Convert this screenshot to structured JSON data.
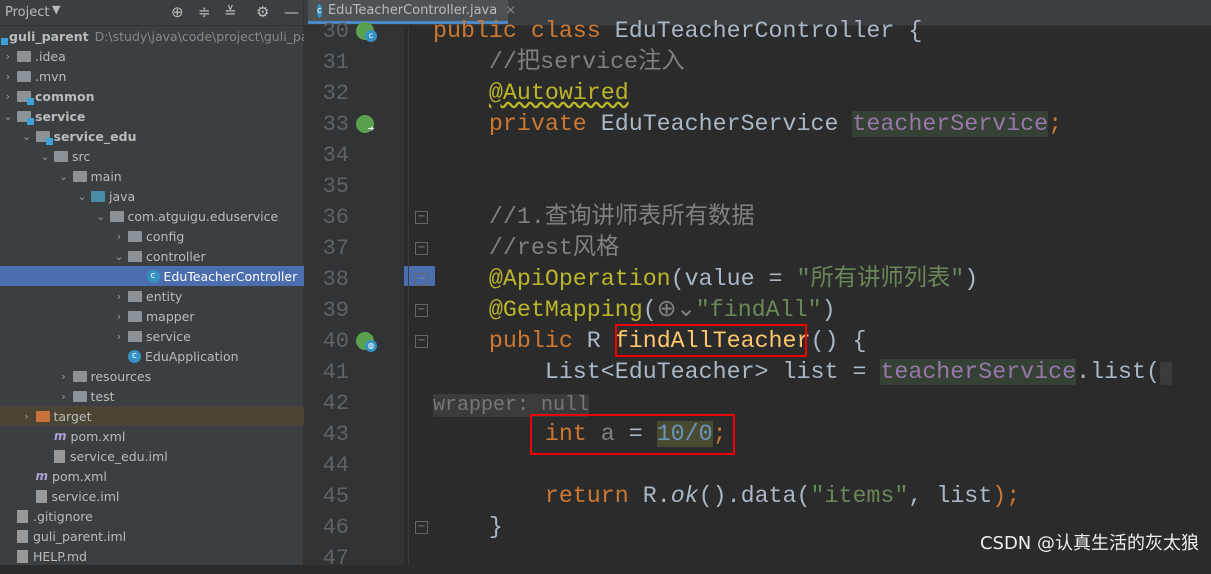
{
  "sidebar": {
    "title": "Project",
    "icons": [
      "dropdown-icon",
      "locate-icon",
      "expand-all-icon",
      "collapse-all-icon",
      "gear-icon",
      "minimize-icon"
    ],
    "items": [
      {
        "label": "guli_parent",
        "path": "D:\\study\\java\\code\\project\\guli_parent",
        "level": 0,
        "icon": "module",
        "bold": true
      },
      {
        "label": ".idea",
        "level": 1,
        "arrow": "right",
        "icon": "folder"
      },
      {
        "label": ".mvn",
        "level": 1,
        "arrow": "right",
        "icon": "folder"
      },
      {
        "label": "common",
        "level": 1,
        "arrow": "right",
        "icon": "module",
        "bold": true
      },
      {
        "label": "service",
        "level": 1,
        "arrow": "down",
        "icon": "module",
        "bold": true
      },
      {
        "label": "service_edu",
        "level": 2,
        "arrow": "down",
        "icon": "module",
        "bold": true
      },
      {
        "label": "src",
        "level": 3,
        "arrow": "down",
        "icon": "folder"
      },
      {
        "label": "main",
        "level": 4,
        "arrow": "down",
        "icon": "folder"
      },
      {
        "label": "java",
        "level": 5,
        "arrow": "down",
        "icon": "blue"
      },
      {
        "label": "com.atguigu.eduservice",
        "level": 6,
        "arrow": "down",
        "icon": "pkg"
      },
      {
        "label": "config",
        "level": 7,
        "arrow": "right",
        "icon": "pkg"
      },
      {
        "label": "controller",
        "level": 7,
        "arrow": "down",
        "icon": "pkg"
      },
      {
        "label": "EduTeacherController",
        "level": 8,
        "icon": "class",
        "selected": true
      },
      {
        "label": "entity",
        "level": 7,
        "arrow": "right",
        "icon": "pkg"
      },
      {
        "label": "mapper",
        "level": 7,
        "arrow": "right",
        "icon": "pkg"
      },
      {
        "label": "service",
        "level": 7,
        "arrow": "right",
        "icon": "pkg"
      },
      {
        "label": "EduApplication",
        "level": 7,
        "icon": "class"
      },
      {
        "label": "resources",
        "level": 4,
        "arrow": "right",
        "icon": "folder"
      },
      {
        "label": "test",
        "level": 4,
        "arrow": "right",
        "icon": "folder"
      },
      {
        "label": "target",
        "level": 2,
        "arrow": "right",
        "icon": "orange",
        "target": true
      },
      {
        "label": "pom.xml",
        "level": 3,
        "icon": "maven"
      },
      {
        "label": "service_edu.iml",
        "level": 3,
        "icon": "file"
      },
      {
        "label": "pom.xml",
        "level": 2,
        "icon": "maven"
      },
      {
        "label": "service.iml",
        "level": 2,
        "icon": "file"
      },
      {
        "label": ".gitignore",
        "level": 1,
        "icon": "file"
      },
      {
        "label": "guli_parent.iml",
        "level": 1,
        "icon": "file"
      },
      {
        "label": "HELP.md",
        "level": 1,
        "icon": "file"
      }
    ]
  },
  "editor": {
    "tab": {
      "label": "EduTeacherController.java",
      "icon": "class-icon"
    },
    "lines": [
      {
        "n": "30",
        "t": [
          [
            "public class ",
            "kw"
          ],
          [
            "EduTeacherController {",
            ""
          ]
        ],
        "gutter": "spring-class"
      },
      {
        "n": "31",
        "t": [
          [
            "    //把service注入",
            "cm"
          ]
        ]
      },
      {
        "n": "32",
        "t": [
          [
            "    ",
            ""
          ],
          [
            "@Autowired",
            "an anu"
          ]
        ]
      },
      {
        "n": "33",
        "t": [
          [
            "    private ",
            "kw"
          ],
          [
            "EduTeacherService ",
            ""
          ],
          [
            "teacherService",
            "fd"
          ],
          [
            ";",
            "kw"
          ]
        ],
        "gutter": "spring-inject"
      },
      {
        "n": "34",
        "t": []
      },
      {
        "n": "35",
        "t": []
      },
      {
        "n": "36",
        "t": [
          [
            "    //1.查询讲师表所有数据",
            "cm"
          ]
        ],
        "fold": true
      },
      {
        "n": "37",
        "t": [
          [
            "    //rest风格",
            "cm"
          ]
        ],
        "fold": true
      },
      {
        "n": "38",
        "t": [
          [
            "    ",
            ""
          ],
          [
            "@ApiOperation",
            "an"
          ],
          [
            "(value = ",
            ""
          ],
          [
            "\"所有讲师列表\"",
            "st"
          ],
          [
            ")",
            ""
          ]
        ],
        "fold": true
      },
      {
        "n": "39",
        "t": [
          [
            "    ",
            ""
          ],
          [
            "@GetMapping",
            "an"
          ],
          [
            "(",
            ""
          ],
          [
            "⊕⌄",
            "dim"
          ],
          [
            "\"findAll\"",
            "st"
          ],
          [
            ")",
            ""
          ]
        ],
        "fold": true
      },
      {
        "n": "40",
        "t": [
          [
            "    public ",
            "kw"
          ],
          [
            "R ",
            ""
          ],
          [
            "findAllTeacher",
            "fn"
          ],
          [
            "() {",
            ""
          ]
        ],
        "gutter": "spring-web",
        "fold": true
      },
      {
        "n": "41",
        "t": [
          [
            "        List<EduTeacher> list = ",
            ""
          ],
          [
            "teacherService",
            "fd"
          ],
          [
            ".list(",
            ""
          ],
          [
            " wrapper: null",
            "hint"
          ]
        ]
      },
      {
        "n": "42",
        "t": []
      },
      {
        "n": "43",
        "t": [
          [
            "        int ",
            "kw"
          ],
          [
            "a ",
            "dim"
          ],
          [
            "= ",
            ""
          ],
          [
            "10/0",
            "num"
          ],
          [
            ";",
            "kw"
          ]
        ]
      },
      {
        "n": "44",
        "t": []
      },
      {
        "n": "45",
        "t": [
          [
            "        return ",
            "kw"
          ],
          [
            "R.",
            ""
          ],
          [
            "ok",
            "it"
          ],
          [
            "().data(",
            ""
          ],
          [
            "\"items\"",
            "st"
          ],
          [
            ", list",
            ""
          ],
          [
            ");",
            "kw"
          ]
        ]
      },
      {
        "n": "46",
        "t": [
          [
            "    }",
            ""
          ]
        ],
        "fold": true
      },
      {
        "n": "47",
        "t": []
      }
    ]
  },
  "watermark": "CSDN @认真生活的灰太狼",
  "colors": {
    "highlight_box": "#ee0000",
    "selection": "#4b6eaf",
    "accent": "#4a88c7"
  }
}
